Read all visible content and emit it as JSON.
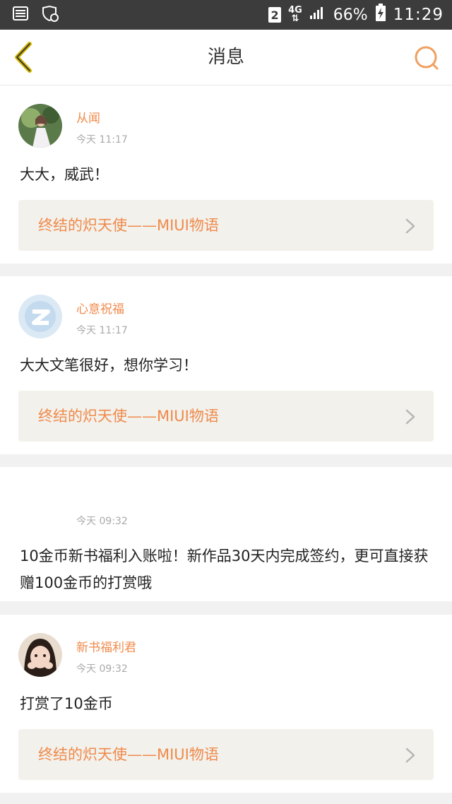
{
  "status_bar": {
    "sim": "2",
    "network": "4G",
    "battery": "66%",
    "time": "11:29"
  },
  "nav": {
    "title": "消息",
    "accent": "#f0a060",
    "back_color": "#d4b800"
  },
  "messages": [
    {
      "sender": "从闻",
      "time": "今天 11:17",
      "text": "大大，威武！",
      "link": "终结的炽天使——MIUI物语"
    },
    {
      "sender": "心意祝福",
      "time": "今天 11:17",
      "text": "大大文笔很好，想你学习！",
      "link": "终结的炽天使——MIUI物语"
    },
    {
      "sender": "",
      "time": "今天 09:32",
      "text": "10金币新书福利入账啦！新作品30天内完成签约，更可直接获赠100金币的打赏哦"
    },
    {
      "sender": "新书福利君",
      "time": "今天 09:32",
      "text": "打赏了10金币",
      "link": "终结的炽天使——MIUI物语"
    }
  ]
}
